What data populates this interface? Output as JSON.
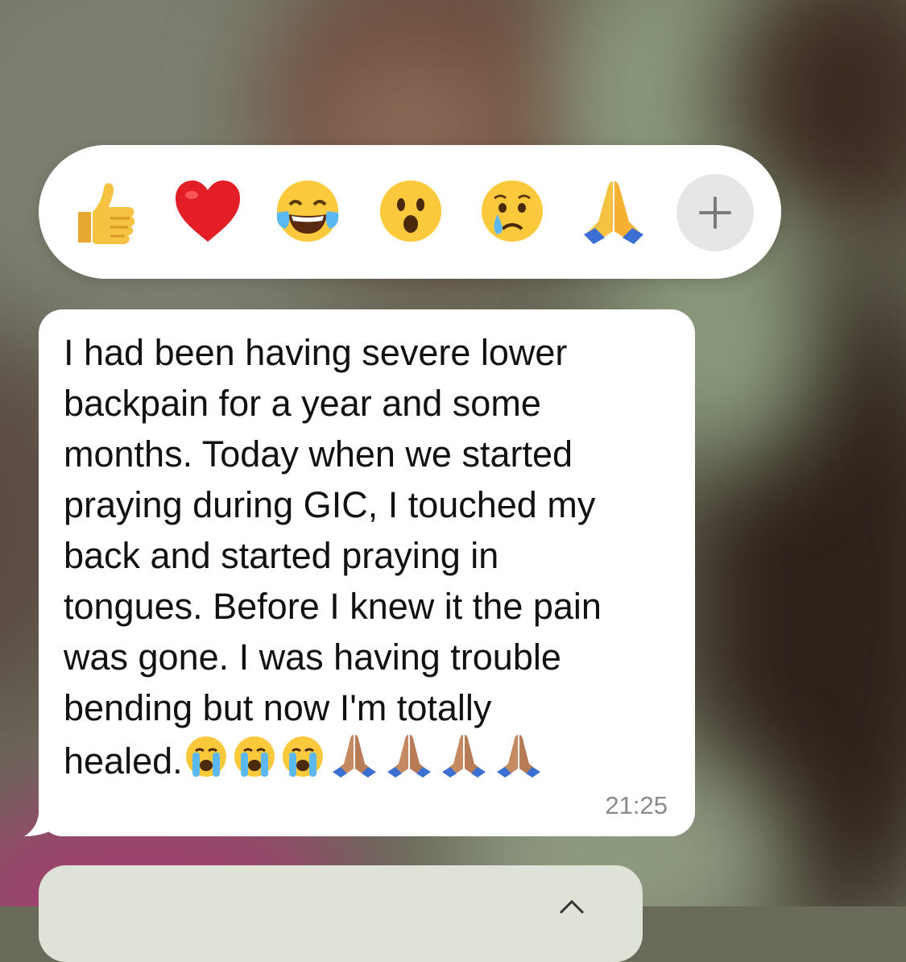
{
  "reactions": {
    "items": [
      {
        "name": "thumbs-up",
        "glyph": "👍"
      },
      {
        "name": "red-heart",
        "glyph": "❤️"
      },
      {
        "name": "face-with-tears-of-joy",
        "glyph": "😂"
      },
      {
        "name": "face-with-open-mouth",
        "glyph": "😮"
      },
      {
        "name": "crying-face",
        "glyph": "😢"
      },
      {
        "name": "folded-hands",
        "glyph": "🙏"
      }
    ],
    "more_icon": "plus-icon"
  },
  "message": {
    "text": "I had been having severe lower\nbackpain for a year and some\nmonths. Today when we started\npraying during GIC, I touched my\nback and started praying in\ntongues. Before I knew it the pain\nwas gone. I was having trouble\nbending but now I'm totally\nhealed.",
    "trailing_emojis": [
      "loudly-crying-face",
      "loudly-crying-face",
      "loudly-crying-face",
      "folded-hands-medium-skin",
      "folded-hands-medium-skin",
      "folded-hands-medium-skin",
      "folded-hands-medium-skin"
    ],
    "time": "21:25"
  },
  "colors": {
    "bubble": "#ffffff",
    "timestamp": "#8a8a8a",
    "plus_button_bg": "#e6e6e6"
  }
}
